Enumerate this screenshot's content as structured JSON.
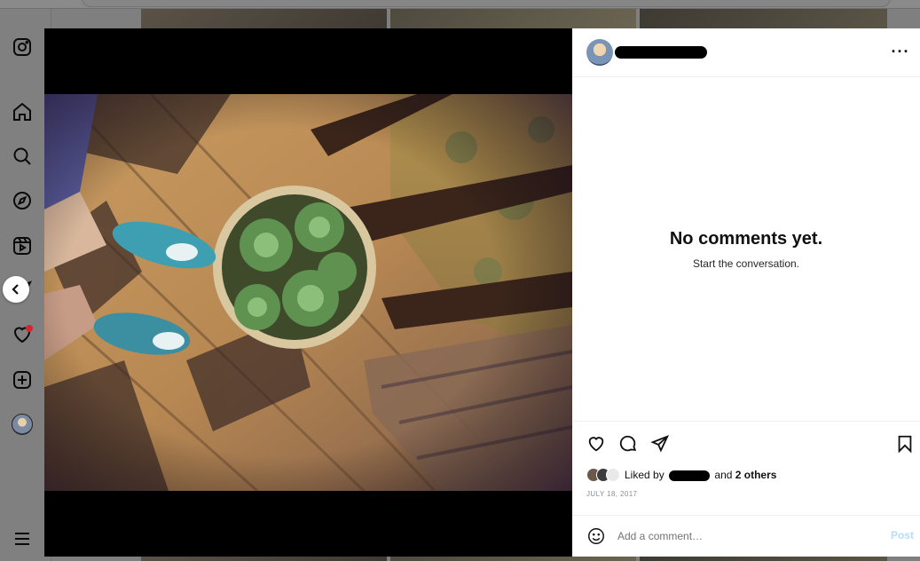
{
  "nav": {
    "items": [
      "instagram-icon",
      "home-icon",
      "search-icon",
      "explore-icon",
      "reels-icon",
      "messages-icon",
      "notifications-icon",
      "create-icon",
      "profile-avatar",
      "menu-icon"
    ]
  },
  "post": {
    "more_label": "···",
    "empty_title": "No comments yet.",
    "empty_subtitle": "Start the conversation.",
    "liked_by_prefix": "Liked by",
    "liked_by_and": "and",
    "liked_by_others": "2 others",
    "date": "JULY 18, 2017",
    "comment_placeholder": "Add a comment…",
    "post_label": "Post"
  },
  "colors": {
    "notification_dot": "#d3262f",
    "post_button_disabled": "#b2dffc",
    "date_text": "#8e8e8e"
  }
}
